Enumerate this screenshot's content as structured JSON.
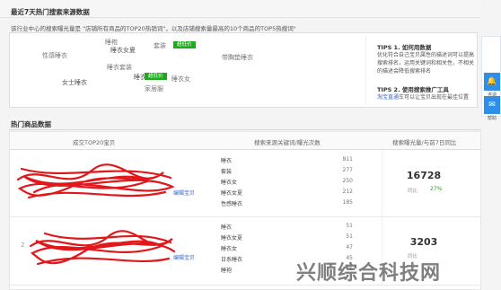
{
  "header": {
    "title": "最近7天热门搜索来源数据"
  },
  "description": "该行业中心的搜索曝光量是 \"店铺所有商品的TOP20热销词\"，以及店铺搜索量最高的10个商品的TOP5热搜词\"",
  "wordcloud": {
    "words": [
      "睡袍",
      "套装",
      "睡衣女夏",
      "性感睡衣",
      "带胸垫睡衣",
      "睡衣套装",
      "女士睡衣",
      "睡衣女",
      "睡衣",
      "家居服"
    ],
    "badge_label": "超低价"
  },
  "tips": {
    "tip1_title": "TIPS 1. 如何用数据",
    "tip1_text": "优化符合自己宝贝属性的描述词可以提高搜索排名，运用关键词和相关性，不相关的描述会降低搜索排名",
    "tip2_title": "TIPS 2. 使用搜索推广工具",
    "tip2_link": "淘宝直通车",
    "tip2_text": "可以让宝贝出现在最佳位置"
  },
  "section_title": "热门商品数据",
  "table": {
    "col_product": "成交TOP20宝贝",
    "col_keywords": "搜索来源关键词/曝光次数",
    "col_exposure": "搜索曝光量/与前7日同比",
    "rows": [
      {
        "index": "",
        "edit_label": "编辑宝贝",
        "keywords": [
          {
            "word": "睡衣",
            "count": "811"
          },
          {
            "word": "套装",
            "count": "277"
          },
          {
            "word": "睡衣女",
            "count": "250"
          },
          {
            "word": "睡衣女夏",
            "count": "212"
          },
          {
            "word": "性感睡衣",
            "count": "185"
          }
        ],
        "exposure": "16728",
        "change_label": "同比",
        "change_value": "27%"
      },
      {
        "index": "2",
        "edit_label": "编辑宝贝",
        "keywords": [
          {
            "word": "睡衣",
            "count": "51"
          },
          {
            "word": "睡衣女夏",
            "count": "51"
          },
          {
            "word": "睡衣女",
            "count": "47"
          },
          {
            "word": "日系睡衣",
            "count": "45"
          },
          {
            "word": "睡袍",
            "count": "45"
          }
        ],
        "exposure": "3203",
        "change_label": "同比",
        "change_value": ""
      }
    ]
  },
  "sidebar": {
    "btn1_label": "咨询",
    "btn2_label": "帮助"
  },
  "watermark": "兴顺综合科技网",
  "colors": {
    "accent": "#1aad19",
    "link": "#3a66c4",
    "sidebar": "#2e8ee8",
    "scribble": "#e0171b"
  }
}
